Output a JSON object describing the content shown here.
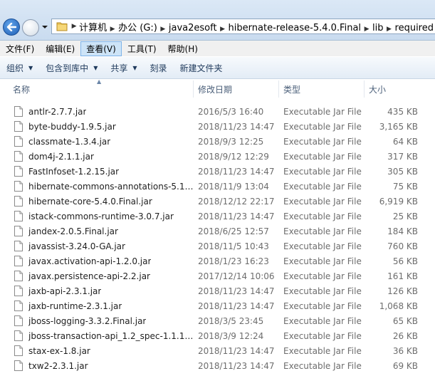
{
  "breadcrumb": [
    "计算机",
    "办公 (G:)",
    "java2esoft",
    "hibernate-release-5.4.0.Final",
    "lib",
    "required"
  ],
  "menu": [
    "文件(F)",
    "编辑(E)",
    "查看(V)",
    "工具(T)",
    "帮助(H)"
  ],
  "active_menu_index": 2,
  "toolbar": {
    "organize": "组织",
    "include_in_library": "包含到库中",
    "share": "共享",
    "burn": "刻录",
    "new_folder": "新建文件夹"
  },
  "columns": {
    "name": "名称",
    "date": "修改日期",
    "type": "类型",
    "size": "大小"
  },
  "files": [
    {
      "name": "antlr-2.7.7.jar",
      "date": "2016/5/3 16:40",
      "type": "Executable Jar File",
      "size": "435 KB"
    },
    {
      "name": "byte-buddy-1.9.5.jar",
      "date": "2018/11/23 14:47",
      "type": "Executable Jar File",
      "size": "3,165 KB"
    },
    {
      "name": "classmate-1.3.4.jar",
      "date": "2018/9/3 12:25",
      "type": "Executable Jar File",
      "size": "64 KB"
    },
    {
      "name": "dom4j-2.1.1.jar",
      "date": "2018/9/12 12:29",
      "type": "Executable Jar File",
      "size": "317 KB"
    },
    {
      "name": "FastInfoset-1.2.15.jar",
      "date": "2018/11/23 14:47",
      "type": "Executable Jar File",
      "size": "305 KB"
    },
    {
      "name": "hibernate-commons-annotations-5.1....",
      "date": "2018/11/9 13:04",
      "type": "Executable Jar File",
      "size": "75 KB"
    },
    {
      "name": "hibernate-core-5.4.0.Final.jar",
      "date": "2018/12/12 22:17",
      "type": "Executable Jar File",
      "size": "6,919 KB"
    },
    {
      "name": "istack-commons-runtime-3.0.7.jar",
      "date": "2018/11/23 14:47",
      "type": "Executable Jar File",
      "size": "25 KB"
    },
    {
      "name": "jandex-2.0.5.Final.jar",
      "date": "2018/6/25 12:57",
      "type": "Executable Jar File",
      "size": "184 KB"
    },
    {
      "name": "javassist-3.24.0-GA.jar",
      "date": "2018/11/5 10:43",
      "type": "Executable Jar File",
      "size": "760 KB"
    },
    {
      "name": "javax.activation-api-1.2.0.jar",
      "date": "2018/1/23 16:23",
      "type": "Executable Jar File",
      "size": "56 KB"
    },
    {
      "name": "javax.persistence-api-2.2.jar",
      "date": "2017/12/14 10:06",
      "type": "Executable Jar File",
      "size": "161 KB"
    },
    {
      "name": "jaxb-api-2.3.1.jar",
      "date": "2018/11/23 14:47",
      "type": "Executable Jar File",
      "size": "126 KB"
    },
    {
      "name": "jaxb-runtime-2.3.1.jar",
      "date": "2018/11/23 14:47",
      "type": "Executable Jar File",
      "size": "1,068 KB"
    },
    {
      "name": "jboss-logging-3.3.2.Final.jar",
      "date": "2018/3/5 23:45",
      "type": "Executable Jar File",
      "size": "65 KB"
    },
    {
      "name": "jboss-transaction-api_1.2_spec-1.1.1....",
      "date": "2018/3/9 12:24",
      "type": "Executable Jar File",
      "size": "26 KB"
    },
    {
      "name": "stax-ex-1.8.jar",
      "date": "2018/11/23 14:47",
      "type": "Executable Jar File",
      "size": "36 KB"
    },
    {
      "name": "txw2-2.3.1.jar",
      "date": "2018/11/23 14:47",
      "type": "Executable Jar File",
      "size": "69 KB"
    }
  ]
}
